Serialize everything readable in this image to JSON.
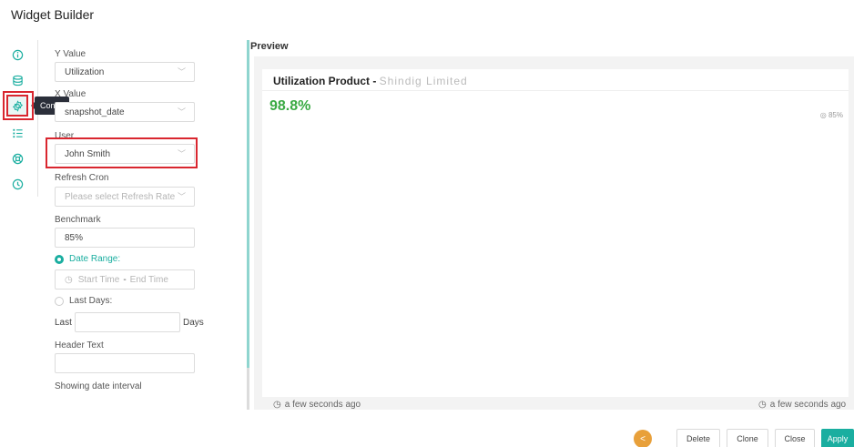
{
  "window": {
    "title": "Widget Builder"
  },
  "rail": {
    "items": [
      {
        "icon": "info-icon"
      },
      {
        "icon": "database-icon"
      },
      {
        "icon": "gear-icon",
        "active": true
      },
      {
        "icon": "list-icon"
      },
      {
        "icon": "support-icon"
      },
      {
        "icon": "clock-icon"
      }
    ],
    "tooltip": "Config"
  },
  "form": {
    "y_value": {
      "label": "Y Value",
      "value": "Utilization"
    },
    "x_value": {
      "label": "X Value",
      "value": "snapshot_date"
    },
    "user": {
      "label": "User",
      "value": "John Smith"
    },
    "refresh_cron": {
      "label": "Refresh Cron",
      "placeholder": "Please select Refresh Rate"
    },
    "benchmark": {
      "label": "Benchmark",
      "value": "85%"
    },
    "date_range": {
      "label": "Date Range:",
      "start_placeholder": "Start Time",
      "separator": "-",
      "end_placeholder": "End Time"
    },
    "last_days": {
      "label": "Last Days:",
      "prefix": "Last",
      "suffix": "Days",
      "value": ""
    },
    "header_text": {
      "label": "Header Text",
      "value": ""
    },
    "showing_date_interval": {
      "label": "Showing date interval"
    }
  },
  "preview": {
    "title": "Preview",
    "card_title": "Utilization Product - ",
    "card_title_blurred": "Shindig Limited",
    "metric": "98.8%",
    "benchmark": "85%",
    "footer_left": "a few seconds ago",
    "footer_right": "a few seconds ago"
  },
  "buttons": {
    "delete": "Delete",
    "clone": "Clone",
    "close": "Close",
    "apply": "Apply"
  },
  "colors": {
    "accent": "#1aaea0",
    "metric": "#3aaa43",
    "highlight": "#d9262f",
    "share": "#e8a03a"
  }
}
